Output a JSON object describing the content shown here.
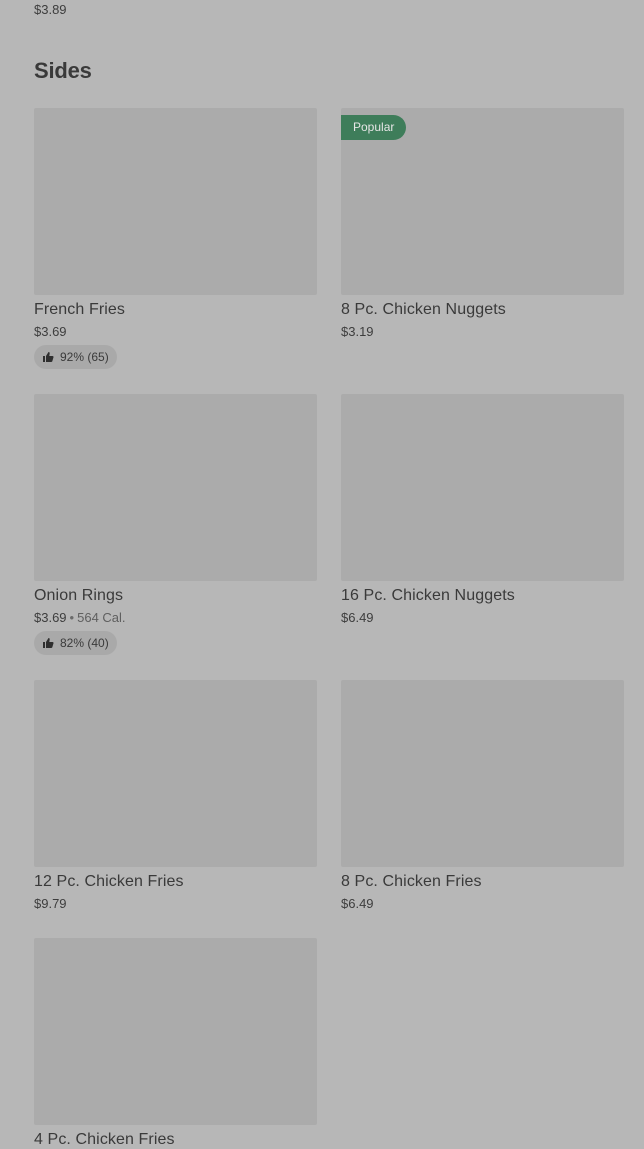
{
  "previous_section": {
    "last_price": "$3.89"
  },
  "section": {
    "title": "Sides"
  },
  "items": [
    {
      "name": "French Fries",
      "price": "$3.69",
      "calories": "",
      "badge": "",
      "rating": "92% (65)"
    },
    {
      "name": "8 Pc. Chicken Nuggets",
      "price": "$3.19",
      "calories": "",
      "badge": "Popular",
      "rating": ""
    },
    {
      "name": "Onion Rings",
      "price": "$3.69",
      "calories": "564 Cal.",
      "badge": "",
      "rating": "82% (40)"
    },
    {
      "name": "16 Pc. Chicken Nuggets",
      "price": "$6.49",
      "calories": "",
      "badge": "",
      "rating": ""
    },
    {
      "name": "12 Pc. Chicken Fries",
      "price": "$9.79",
      "calories": "",
      "badge": "",
      "rating": ""
    },
    {
      "name": "8 Pc. Chicken Fries",
      "price": "$6.49",
      "calories": "",
      "badge": "",
      "rating": ""
    },
    {
      "name": "4 Pc. Chicken Fries",
      "price": "",
      "calories": "",
      "badge": "",
      "rating": ""
    }
  ],
  "icons": {
    "rating_icon": "thumbs-up-icon"
  },
  "colors": {
    "background": "#b7b7b7",
    "image_placeholder": "#ababab",
    "badge_background": "#3e7d5a",
    "rating_pill": "#a9a9a9"
  }
}
